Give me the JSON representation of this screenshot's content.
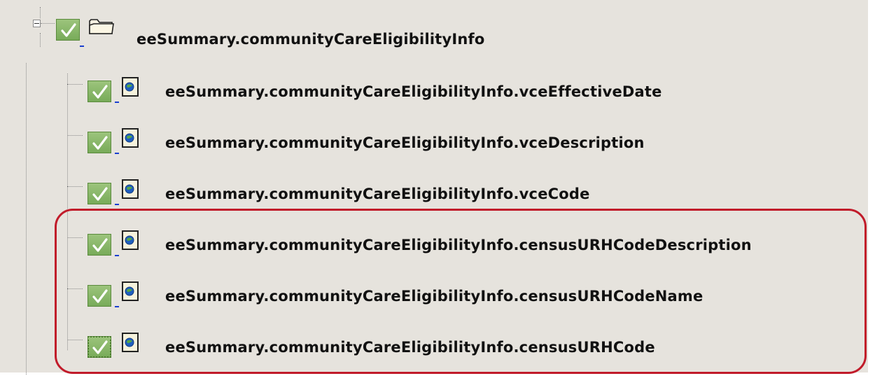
{
  "tree": {
    "root": {
      "label": "eeSummary.communityCareEligibilityInfo",
      "expanded": true,
      "checked": true,
      "icon": "folder-icon"
    },
    "children": [
      {
        "label": "eeSummary.communityCareEligibilityInfo.vceEffectiveDate",
        "checked": true,
        "icon": "document-icon"
      },
      {
        "label": "eeSummary.communityCareEligibilityInfo.vceDescription",
        "checked": true,
        "icon": "document-icon"
      },
      {
        "label": "eeSummary.communityCareEligibilityInfo.vceCode",
        "checked": true,
        "icon": "document-icon"
      },
      {
        "label": "eeSummary.communityCareEligibilityInfo.censusURHCodeDescription",
        "checked": true,
        "icon": "document-icon"
      },
      {
        "label": "eeSummary.communityCareEligibilityInfo.censusURHCodeName",
        "checked": true,
        "icon": "document-icon"
      },
      {
        "label": "eeSummary.communityCareEligibilityInfo.censusURHCode",
        "checked": true,
        "focused": true,
        "icon": "document-icon"
      }
    ]
  },
  "annotation": {
    "type": "highlight-box",
    "color": "#c11b2a",
    "covers": "last three child items"
  },
  "colors": {
    "panel_background": "#e6e3dd",
    "checkbox_green": "#78ab59"
  }
}
